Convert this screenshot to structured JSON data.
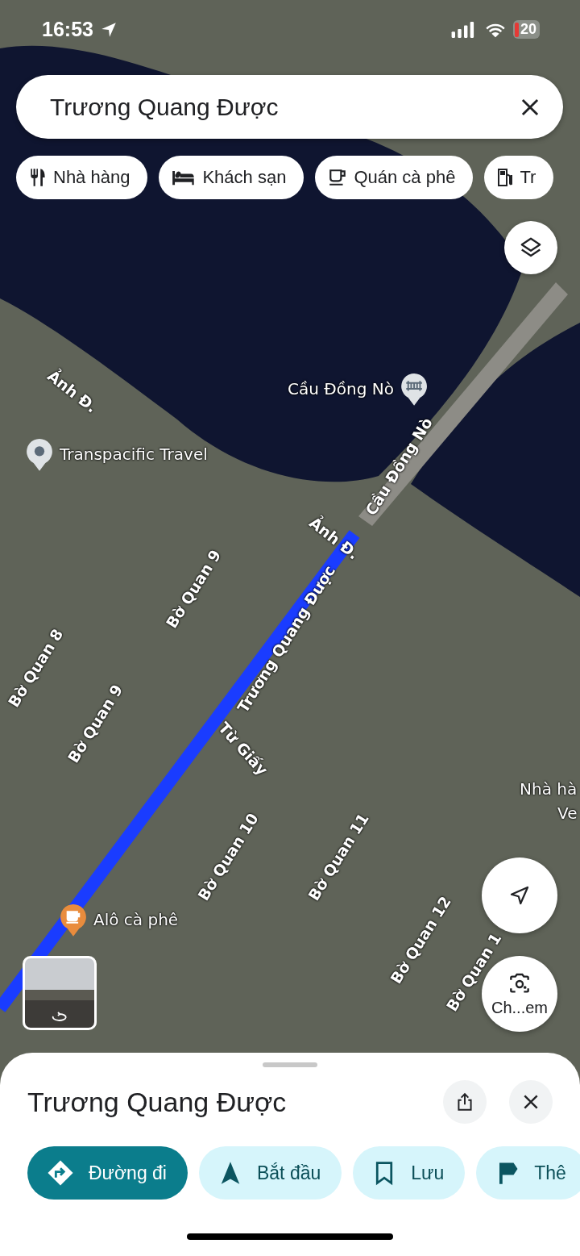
{
  "status_bar": {
    "time": "16:53",
    "battery": "20"
  },
  "search": {
    "value": "Trương Quang Được"
  },
  "chips": [
    {
      "label": "Nhà hàng",
      "kind": "restaurant"
    },
    {
      "label": "Khách sạn",
      "kind": "hotel"
    },
    {
      "label": "Quán cà phê",
      "kind": "cafe"
    },
    {
      "label": "Tr",
      "kind": "gas"
    }
  ],
  "map": {
    "labels": [
      {
        "text": "Ảnh Đ.",
        "kind": "street"
      },
      {
        "text": "Cầu Đồng Nò",
        "kind": "bridge"
      },
      {
        "text": "Transpacific Travel",
        "kind": "place"
      },
      {
        "text": "Cầu Đồng Nò",
        "kind": "street"
      },
      {
        "text": "Ảnh Đ.",
        "kind": "street"
      },
      {
        "text": "Bờ Quan 9",
        "kind": "street"
      },
      {
        "text": "Trương Quang Được",
        "kind": "street"
      },
      {
        "text": "Bờ Quan 8",
        "kind": "street"
      },
      {
        "text": "Bờ Quan 9",
        "kind": "street"
      },
      {
        "text": "Từ Giấy",
        "kind": "street"
      },
      {
        "text": "Nhà hà",
        "kind": "text"
      },
      {
        "text": "Ve",
        "kind": "text"
      },
      {
        "text": "Bờ Quan 10",
        "kind": "street"
      },
      {
        "text": "Bờ Quan 11",
        "kind": "street"
      },
      {
        "text": "Bờ Quan 12",
        "kind": "street"
      },
      {
        "text": "Alô cà phê",
        "kind": "cafe"
      },
      {
        "text": "Bờ Quan 1",
        "kind": "street"
      }
    ]
  },
  "camera_button": {
    "label": "Ch...em"
  },
  "place_sheet": {
    "title": "Trương Quang Được",
    "actions": [
      {
        "label": "Đường đi",
        "kind": "directions",
        "selected": true
      },
      {
        "label": "Bắt đầu",
        "kind": "start",
        "selected": false
      },
      {
        "label": "Lưu",
        "kind": "save",
        "selected": false
      },
      {
        "label": "Thê",
        "kind": "flag",
        "selected": false
      }
    ]
  }
}
